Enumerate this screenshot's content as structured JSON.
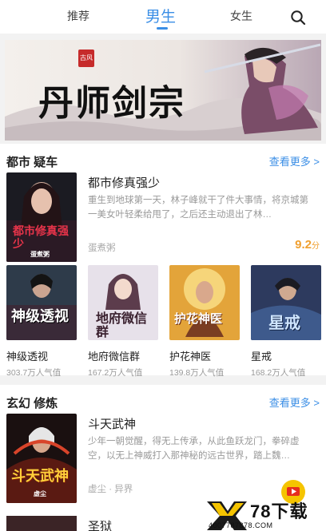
{
  "nav": {
    "tabs": [
      {
        "label": "推荐",
        "active": false
      },
      {
        "label": "男生",
        "active": true
      },
      {
        "label": "女生",
        "active": false
      }
    ],
    "search_icon": "search-icon",
    "accent": "#3a8ee6"
  },
  "banner": {
    "title": "丹师剑宗",
    "seal": "古风"
  },
  "sections": [
    {
      "title": "都市 疑车",
      "more": "查看更多 >",
      "featured": {
        "title": "都市修真强少",
        "desc": "重生到地球第一天，林子峰就干了件大事情，将京城第一美女叶轻柔给甩了，之后还主动退出了林…",
        "author": "蛋煮粥",
        "score": "9.2",
        "score_unit": "分",
        "cover_text": "都市修真强少",
        "cover_author": "蛋煮粥"
      },
      "grid": [
        {
          "title": "神级透视",
          "pop": "303.7万人气值",
          "cover_text": "神级透视"
        },
        {
          "title": "地府微信群",
          "pop": "167.2万人气值",
          "cover_text": "地府微信群"
        },
        {
          "title": "护花神医",
          "pop": "139.8万人气值",
          "cover_text": "护花神医"
        },
        {
          "title": "星戒",
          "pop": "168.2万人气值",
          "cover_text": "星戒"
        }
      ]
    },
    {
      "title": "玄幻 修炼",
      "more": "查看更多 >",
      "featured": {
        "title": "斗天武神",
        "desc": "少年一朝觉醒，得无上传承，从此鱼跃龙门，拳碎虚空，以无上神威打入那神秘的远古世界，踏上魏…",
        "author": "虚尘 · 异界",
        "cover_text": "斗天武神",
        "cover_author": "虚尘"
      },
      "next_title": "圣狱"
    }
  ],
  "watermark": {
    "text": "78下载",
    "url": "4007787878.COM"
  }
}
